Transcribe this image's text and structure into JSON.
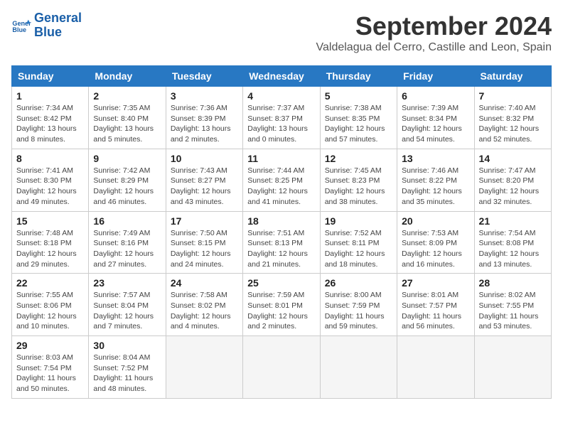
{
  "logo": {
    "line1": "General",
    "line2": "Blue"
  },
  "title": "September 2024",
  "location": "Valdelagua del Cerro, Castille and Leon, Spain",
  "days_header": [
    "Sunday",
    "Monday",
    "Tuesday",
    "Wednesday",
    "Thursday",
    "Friday",
    "Saturday"
  ],
  "weeks": [
    [
      {
        "day": "1",
        "sunrise": "7:34 AM",
        "sunset": "8:42 PM",
        "daylight": "13 hours and 8 minutes."
      },
      {
        "day": "2",
        "sunrise": "7:35 AM",
        "sunset": "8:40 PM",
        "daylight": "13 hours and 5 minutes."
      },
      {
        "day": "3",
        "sunrise": "7:36 AM",
        "sunset": "8:39 PM",
        "daylight": "13 hours and 2 minutes."
      },
      {
        "day": "4",
        "sunrise": "7:37 AM",
        "sunset": "8:37 PM",
        "daylight": "13 hours and 0 minutes."
      },
      {
        "day": "5",
        "sunrise": "7:38 AM",
        "sunset": "8:35 PM",
        "daylight": "12 hours and 57 minutes."
      },
      {
        "day": "6",
        "sunrise": "7:39 AM",
        "sunset": "8:34 PM",
        "daylight": "12 hours and 54 minutes."
      },
      {
        "day": "7",
        "sunrise": "7:40 AM",
        "sunset": "8:32 PM",
        "daylight": "12 hours and 52 minutes."
      }
    ],
    [
      {
        "day": "8",
        "sunrise": "7:41 AM",
        "sunset": "8:30 PM",
        "daylight": "12 hours and 49 minutes."
      },
      {
        "day": "9",
        "sunrise": "7:42 AM",
        "sunset": "8:29 PM",
        "daylight": "12 hours and 46 minutes."
      },
      {
        "day": "10",
        "sunrise": "7:43 AM",
        "sunset": "8:27 PM",
        "daylight": "12 hours and 43 minutes."
      },
      {
        "day": "11",
        "sunrise": "7:44 AM",
        "sunset": "8:25 PM",
        "daylight": "12 hours and 41 minutes."
      },
      {
        "day": "12",
        "sunrise": "7:45 AM",
        "sunset": "8:23 PM",
        "daylight": "12 hours and 38 minutes."
      },
      {
        "day": "13",
        "sunrise": "7:46 AM",
        "sunset": "8:22 PM",
        "daylight": "12 hours and 35 minutes."
      },
      {
        "day": "14",
        "sunrise": "7:47 AM",
        "sunset": "8:20 PM",
        "daylight": "12 hours and 32 minutes."
      }
    ],
    [
      {
        "day": "15",
        "sunrise": "7:48 AM",
        "sunset": "8:18 PM",
        "daylight": "12 hours and 29 minutes."
      },
      {
        "day": "16",
        "sunrise": "7:49 AM",
        "sunset": "8:16 PM",
        "daylight": "12 hours and 27 minutes."
      },
      {
        "day": "17",
        "sunrise": "7:50 AM",
        "sunset": "8:15 PM",
        "daylight": "12 hours and 24 minutes."
      },
      {
        "day": "18",
        "sunrise": "7:51 AM",
        "sunset": "8:13 PM",
        "daylight": "12 hours and 21 minutes."
      },
      {
        "day": "19",
        "sunrise": "7:52 AM",
        "sunset": "8:11 PM",
        "daylight": "12 hours and 18 minutes."
      },
      {
        "day": "20",
        "sunrise": "7:53 AM",
        "sunset": "8:09 PM",
        "daylight": "12 hours and 16 minutes."
      },
      {
        "day": "21",
        "sunrise": "7:54 AM",
        "sunset": "8:08 PM",
        "daylight": "12 hours and 13 minutes."
      }
    ],
    [
      {
        "day": "22",
        "sunrise": "7:55 AM",
        "sunset": "8:06 PM",
        "daylight": "12 hours and 10 minutes."
      },
      {
        "day": "23",
        "sunrise": "7:57 AM",
        "sunset": "8:04 PM",
        "daylight": "12 hours and 7 minutes."
      },
      {
        "day": "24",
        "sunrise": "7:58 AM",
        "sunset": "8:02 PM",
        "daylight": "12 hours and 4 minutes."
      },
      {
        "day": "25",
        "sunrise": "7:59 AM",
        "sunset": "8:01 PM",
        "daylight": "12 hours and 2 minutes."
      },
      {
        "day": "26",
        "sunrise": "8:00 AM",
        "sunset": "7:59 PM",
        "daylight": "11 hours and 59 minutes."
      },
      {
        "day": "27",
        "sunrise": "8:01 AM",
        "sunset": "7:57 PM",
        "daylight": "11 hours and 56 minutes."
      },
      {
        "day": "28",
        "sunrise": "8:02 AM",
        "sunset": "7:55 PM",
        "daylight": "11 hours and 53 minutes."
      }
    ],
    [
      {
        "day": "29",
        "sunrise": "8:03 AM",
        "sunset": "7:54 PM",
        "daylight": "11 hours and 50 minutes."
      },
      {
        "day": "30",
        "sunrise": "8:04 AM",
        "sunset": "7:52 PM",
        "daylight": "11 hours and 48 minutes."
      },
      null,
      null,
      null,
      null,
      null
    ]
  ],
  "labels": {
    "sunrise": "Sunrise: ",
    "sunset": "Sunset: ",
    "daylight": "Daylight: "
  }
}
